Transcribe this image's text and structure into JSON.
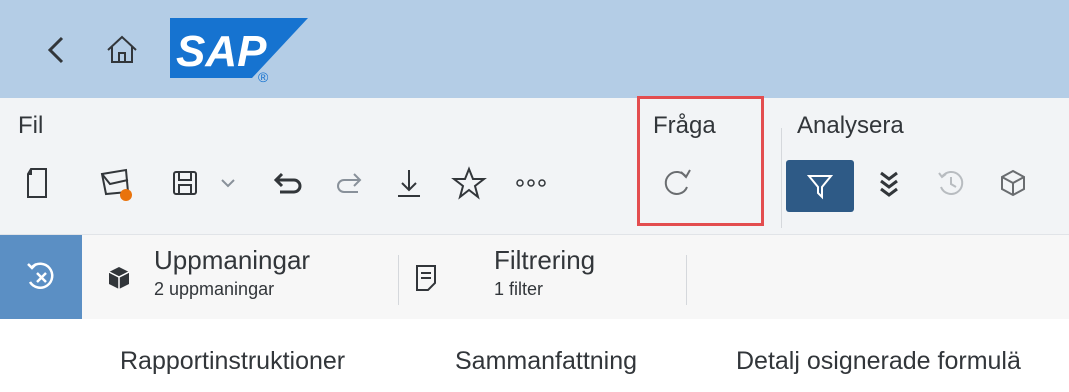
{
  "shell": {
    "back_icon": "chevron-left-icon",
    "home_icon": "home-icon",
    "logo_text": "SAP",
    "logo_registered": "®",
    "colors": {
      "shell_bg": "#b4cde6",
      "logo_blue": "#1673d0"
    }
  },
  "toolbar": {
    "groups": {
      "fil": "Fil",
      "fraga": "Fråga",
      "analysera": "Analysera"
    },
    "highlight_color": "#e34d4f",
    "active_button_color": "#2e5a86"
  },
  "navbar": {
    "prompts_title": "Uppmaningar",
    "prompts_sub": "2 uppmaningar",
    "filter_title": "Filtrering",
    "filter_sub": "1 filter"
  },
  "tabs": [
    {
      "label": "Rapportinstruktioner"
    },
    {
      "label": "Sammanfattning"
    },
    {
      "label": "Detalj osignerade formulä"
    }
  ]
}
